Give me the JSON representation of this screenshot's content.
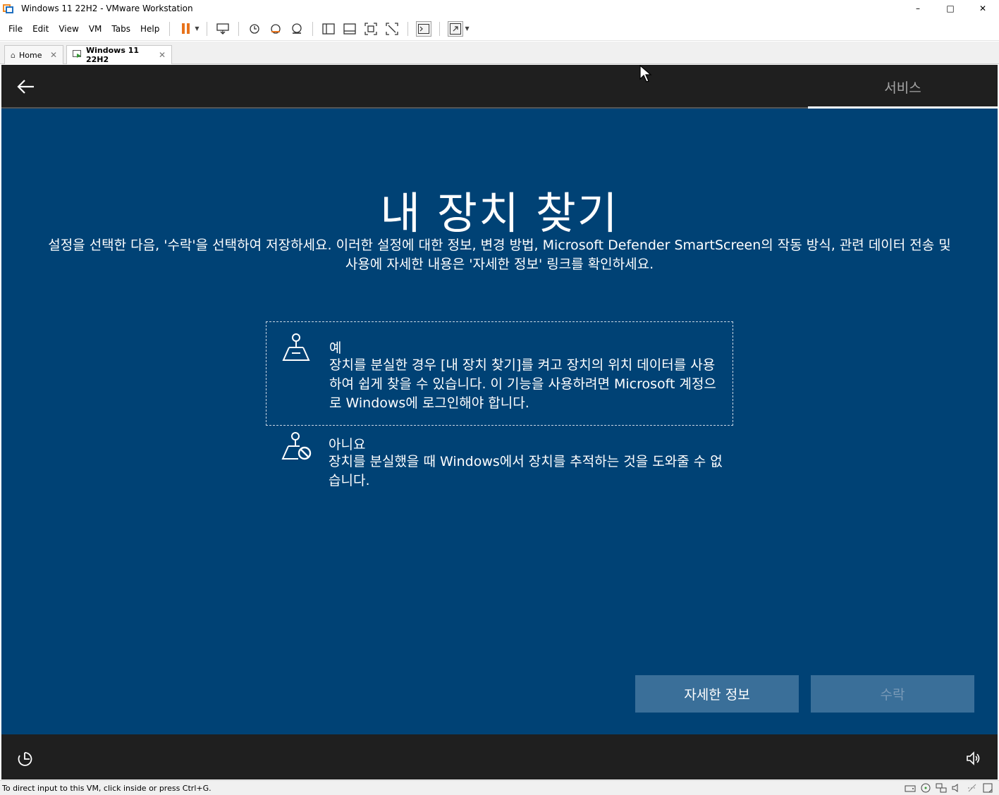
{
  "window": {
    "title": "Windows 11 22H2 - VMware Workstation",
    "minimize": "–",
    "maximize": "□",
    "close": "✕"
  },
  "menu": {
    "items": [
      "File",
      "Edit",
      "View",
      "VM",
      "Tabs",
      "Help"
    ]
  },
  "tabs": [
    {
      "label": "Home",
      "icon": "home-icon"
    },
    {
      "label": "Windows 11 22H2",
      "icon": "vm-icon",
      "active": true
    }
  ],
  "oobe": {
    "step_label": "서비스",
    "heading": "내 장치 찾기",
    "description": "설정을 선택한 다음, '수락'을 선택하여 저장하세요. 이러한 설정에 대한 정보, 변경 방법, Microsoft Defender SmartScreen의 작동 방식, 관련 데이터 전송 및 사용에 자세한 내용은 '자세한 정보' 링크를 확인하세요.",
    "options": [
      {
        "title": "예",
        "body": "장치를 분실한 경우 [내 장치 찾기]를 켜고 장치의 위치 데이터를 사용하여 쉽게 찾을 수 있습니다. 이 기능을 사용하려면 Microsoft 계정으로 Windows에 로그인해야 합니다.",
        "icon": "find-device-icon",
        "selected": true
      },
      {
        "title": "아니요",
        "body": "장치를 분실했을 때 Windows에서 장치를 추적하는 것을 도와줄 수 없습니다.",
        "icon": "find-device-off-icon",
        "selected": false
      }
    ],
    "learn_more_button": "자세한 정보",
    "accept_button": "수락"
  },
  "status": {
    "text": "To direct input to this VM, click inside or press Ctrl+G."
  },
  "colors": {
    "oobe_background": "#004275",
    "oobe_bar": "#1f1f1f",
    "button": "#3a6f99",
    "pause_accent": "#e8731c"
  }
}
